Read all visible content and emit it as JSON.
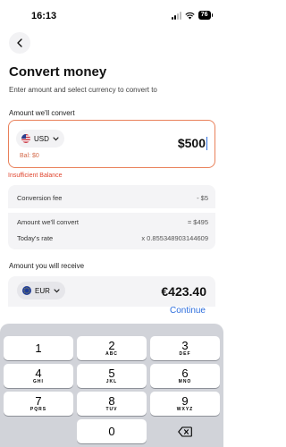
{
  "status_bar": {
    "time": "16:13",
    "battery": "76"
  },
  "header": {
    "title": "Convert money",
    "subtitle": "Enter amount and select currency to convert to"
  },
  "convert_from": {
    "label": "Amount we'll convert",
    "currency": "USD",
    "amount": "$500",
    "balance": "Bal: $0",
    "error": "Insufficient Balance"
  },
  "summary": {
    "conversion_fee_label": "Conversion fee",
    "conversion_fee_value": "- $5",
    "amount_convert_label": "Amount we'll convert",
    "amount_convert_value": "= $495",
    "rate_label": "Today's rate",
    "rate_value": "x 0.855348903144609"
  },
  "convert_to": {
    "label": "Amount you will receive",
    "currency": "EUR",
    "amount": "€423.40"
  },
  "actions": {
    "continue": "Continue"
  },
  "keypad": {
    "keys": [
      {
        "num": "1",
        "letters": ""
      },
      {
        "num": "2",
        "letters": "ABC"
      },
      {
        "num": "3",
        "letters": "DEF"
      },
      {
        "num": "4",
        "letters": "GHI"
      },
      {
        "num": "5",
        "letters": "JKL"
      },
      {
        "num": "6",
        "letters": "MNO"
      },
      {
        "num": "7",
        "letters": "PQRS"
      },
      {
        "num": "8",
        "letters": "TUV"
      },
      {
        "num": "9",
        "letters": "WXYZ"
      },
      {
        "num": "0",
        "letters": ""
      }
    ]
  },
  "colors": {
    "accent_blue": "#2f6fdd",
    "error_red": "#e0452e",
    "card_border_error": "#e9805a"
  },
  "icons": [
    "back-arrow-icon",
    "signal-icon",
    "wifi-icon",
    "battery-icon",
    "us-flag-icon",
    "eu-flag-icon",
    "chevron-down-icon",
    "backspace-icon"
  ]
}
